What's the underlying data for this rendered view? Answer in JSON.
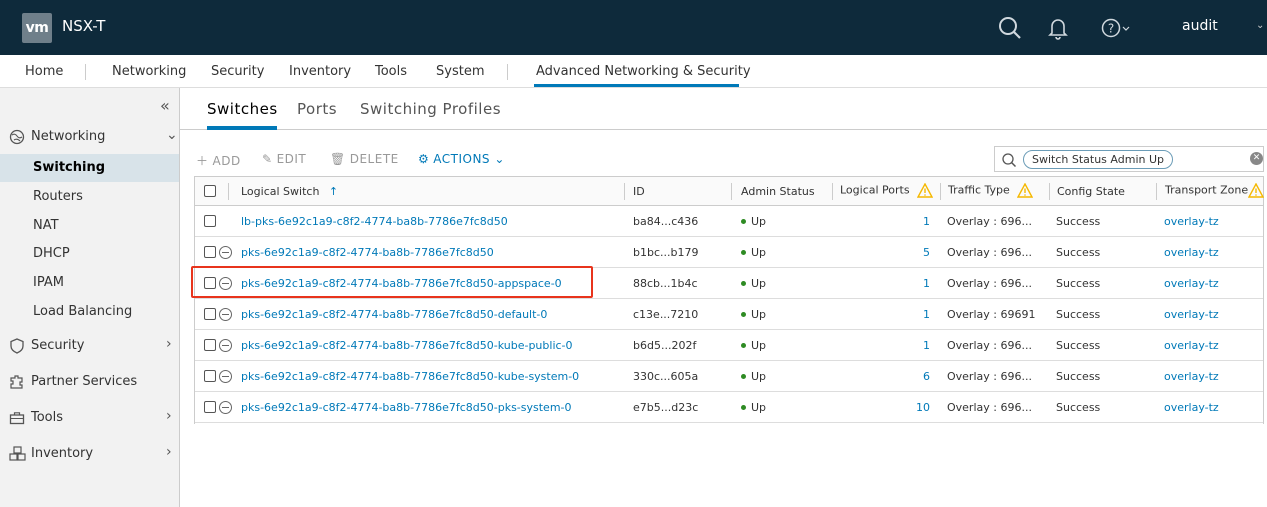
{
  "header": {
    "logo": "vm",
    "app_title": "NSX-T",
    "user": "audit",
    "icons": [
      "search-icon",
      "bell-icon",
      "help-icon"
    ]
  },
  "nav": {
    "items": [
      "Home",
      "Networking",
      "Security",
      "Inventory",
      "Tools",
      "System",
      "Advanced Networking & Security"
    ],
    "active": "Advanced Networking & Security"
  },
  "sidebar": {
    "groups": [
      {
        "label": "Networking",
        "icon": "networking-icon",
        "expanded": true
      },
      {
        "label": "Security",
        "icon": "shield-icon"
      },
      {
        "label": "Partner Services",
        "icon": "partner-services-icon"
      },
      {
        "label": "Tools",
        "icon": "toolbox-icon"
      },
      {
        "label": "Inventory",
        "icon": "inventory-icon"
      }
    ],
    "networking_items": [
      "Switching",
      "Routers",
      "NAT",
      "DHCP",
      "IPAM",
      "Load Balancing"
    ],
    "active_item": "Switching"
  },
  "tabs": {
    "items": [
      "Switches",
      "Ports",
      "Switching Profiles"
    ],
    "active": "Switches"
  },
  "toolbar": {
    "add": "ADD",
    "edit": "EDIT",
    "delete": "DELETE",
    "actions": "ACTIONS"
  },
  "search": {
    "filter_pill": "Switch Status Admin Up"
  },
  "table": {
    "columns": [
      "Logical Switch",
      "ID",
      "Admin Status",
      "Logical Ports",
      "Traffic Type",
      "Config State",
      "Transport Zone"
    ],
    "sort_indicator": "↑",
    "rows": [
      {
        "name": "lb-pks-6e92c1a9-c8f2-4774-ba8b-7786e7fc8d50",
        "id": "ba84...c436",
        "admin_status": "Up",
        "ports": "1",
        "traffic": "Overlay : 696...",
        "config": "Success",
        "zone": "overlay-tz"
      },
      {
        "name": "pks-6e92c1a9-c8f2-4774-ba8b-7786e7fc8d50",
        "id": "b1bc...b179",
        "admin_status": "Up",
        "ports": "5",
        "traffic": "Overlay : 696...",
        "config": "Success",
        "zone": "overlay-tz"
      },
      {
        "name": "pks-6e92c1a9-c8f2-4774-ba8b-7786e7fc8d50-appspace-0",
        "id": "88cb...1b4c",
        "admin_status": "Up",
        "ports": "1",
        "traffic": "Overlay : 696...",
        "config": "Success",
        "zone": "overlay-tz"
      },
      {
        "name": "pks-6e92c1a9-c8f2-4774-ba8b-7786e7fc8d50-default-0",
        "id": "c13e...7210",
        "admin_status": "Up",
        "ports": "1",
        "traffic": "Overlay : 69691",
        "config": "Success",
        "zone": "overlay-tz"
      },
      {
        "name": "pks-6e92c1a9-c8f2-4774-ba8b-7786e7fc8d50-kube-public-0",
        "id": "b6d5...202f",
        "admin_status": "Up",
        "ports": "1",
        "traffic": "Overlay : 696...",
        "config": "Success",
        "zone": "overlay-tz"
      },
      {
        "name": "pks-6e92c1a9-c8f2-4774-ba8b-7786e7fc8d50-kube-system-0",
        "id": "330c...605a",
        "admin_status": "Up",
        "ports": "6",
        "traffic": "Overlay : 696...",
        "config": "Success",
        "zone": "overlay-tz"
      },
      {
        "name": "pks-6e92c1a9-c8f2-4774-ba8b-7786e7fc8d50-pks-system-0",
        "id": "e7b5...d23c",
        "admin_status": "Up",
        "ports": "10",
        "traffic": "Overlay : 696...",
        "config": "Success",
        "zone": "overlay-tz"
      }
    ]
  },
  "colors": {
    "header_bg": "#0e2a3b",
    "accent": "#0079b8",
    "status_up": "#2e8b23",
    "warning": "#f5b800",
    "highlight": "#e8341c"
  }
}
